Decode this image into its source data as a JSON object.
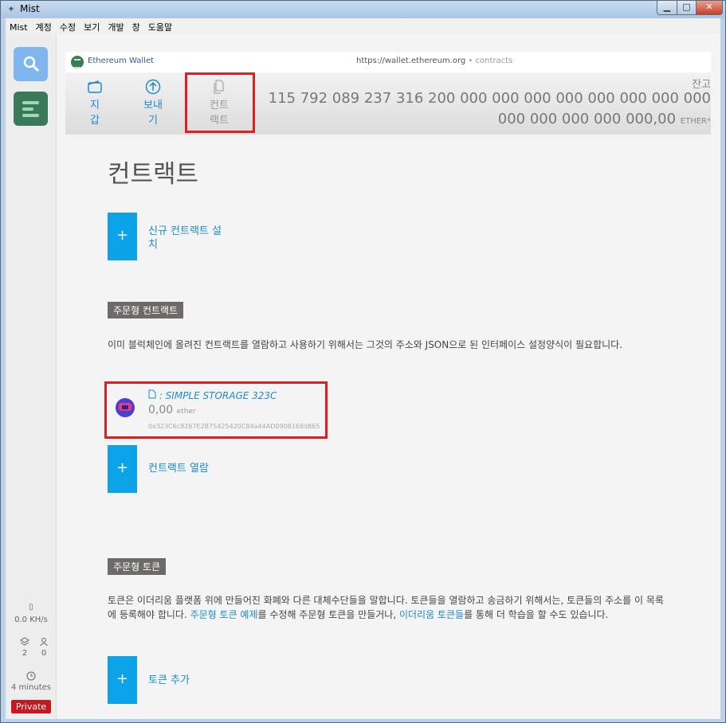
{
  "window": {
    "title": "Mist"
  },
  "menu": [
    "Mist",
    "계정",
    "수정",
    "보기",
    "개발",
    "창",
    "도움말"
  ],
  "sidebar": {
    "hashrate": "0.0 KH/s",
    "blocks": "2",
    "peers": "0",
    "last_block": "4 minutes",
    "network_badge": "Private"
  },
  "address_bar": {
    "app_name": "Ethereum Wallet",
    "url": "https://wallet.ethereum.org",
    "path": " • contracts"
  },
  "nav": {
    "wallets_label": "지\n갑",
    "send_label": "보내\n기",
    "contracts_label": "컨트\n랙트"
  },
  "balance": {
    "label": "잔고",
    "value": "115 792 089 237 316 200 000 000 000 000 000 000 000 000 000 000 000 000 000,00",
    "unit": "ETHER*"
  },
  "page": {
    "title": "컨트랙트",
    "deploy_label": "신규 컨트랙트 설\n치",
    "custom_contracts_tag": "주문형 컨트랙트",
    "custom_contracts_desc": "이미 블럭체인에 올려진 컨트랙트를 열람하고 사용하기 위해서는 그것의 주소와 JSON으로 된 인터페이스 설정양식이 필요합니다.",
    "watch_contract_label": "컨트랙트 열람",
    "custom_tokens_tag": "주문형 토큰",
    "tokens_desc_1": "토큰은 이더리움 플랫폼 위에 만들어진 화폐와 다른 대체수단들을 말합니다. 토큰들을 열람하고 송금하기 위해서는, 토큰들의 주소를 이 목록에 등록해야 합니다. ",
    "tokens_link_1": "주문형 토큰 예제",
    "tokens_desc_2": "를 수정해 주문형 토큰을 만들거나, ",
    "tokens_link_2": "이더리움 토큰들",
    "tokens_desc_3": "를 통해 더 학습을 할 수도 있습니다.",
    "add_token_label": "토큰 추가"
  },
  "contract": {
    "name": ": SIMPLE STORAGE 323C",
    "balance": "0,00",
    "balance_unit": "ether",
    "address": "0x323C6c8267E2B75425420C84a44AD0908168d865"
  },
  "colors": {
    "accent": "#0ba2e8",
    "link": "#1e8bd0",
    "highlight": "#e02020",
    "private": "#c6191f"
  }
}
